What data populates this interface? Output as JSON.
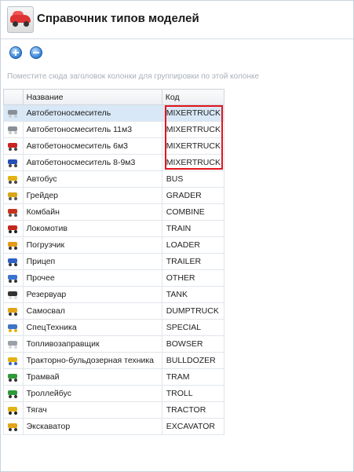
{
  "window": {
    "title": "Справочник типов моделей"
  },
  "toolbar": {
    "add_icon": "plus-circle-icon",
    "remove_icon": "minus-circle-icon"
  },
  "group_panel": {
    "hint": "Поместите сюда заголовок колонки для группировки по этой колонке"
  },
  "table": {
    "columns": [
      "",
      "Название",
      "Код"
    ],
    "rows": [
      {
        "icon": "mixer-truck-icon",
        "name": "Автобетоносмеситель",
        "code": "MIXERTRUCK",
        "selected": true
      },
      {
        "icon": "mixer-truck-icon",
        "name": "Автобетоносмеситель 11м3",
        "code": "MIXERTRUCK"
      },
      {
        "icon": "mixer-truck-red-icon",
        "name": "Автобетоносмеситель 6м3",
        "code": "MIXERTRUCK"
      },
      {
        "icon": "mixer-truck-blue-icon",
        "name": "Автобетоносмеситель 8-9м3",
        "code": "MIXERTRUCK"
      },
      {
        "icon": "bus-icon",
        "name": "Автобус",
        "code": "BUS"
      },
      {
        "icon": "grader-icon",
        "name": "Грейдер",
        "code": "GRADER"
      },
      {
        "icon": "combine-icon",
        "name": "Комбайн",
        "code": "COMBINE"
      },
      {
        "icon": "locomotive-icon",
        "name": "Локомотив",
        "code": "TRAIN"
      },
      {
        "icon": "loader-icon",
        "name": "Погрузчик",
        "code": "LOADER"
      },
      {
        "icon": "trailer-icon",
        "name": "Прицеп",
        "code": "TRAILER"
      },
      {
        "icon": "car-icon",
        "name": "Прочее",
        "code": "OTHER"
      },
      {
        "icon": "tank-icon",
        "name": "Резервуар",
        "code": "TANK"
      },
      {
        "icon": "dumptruck-icon",
        "name": "Самосвал",
        "code": "DUMPTRUCK"
      },
      {
        "icon": "special-vehicle-icon",
        "name": "СпецТехника",
        "code": "SPECIAL"
      },
      {
        "icon": "bowser-icon",
        "name": "Топливозаправщик",
        "code": "BOWSER"
      },
      {
        "icon": "bulldozer-icon",
        "name": "Тракторно-бульдозерная техника",
        "code": "BULLDOZER"
      },
      {
        "icon": "tram-icon",
        "name": "Трамвай",
        "code": "TRAM"
      },
      {
        "icon": "trolleybus-icon",
        "name": "Троллейбус",
        "code": "TROLL"
      },
      {
        "icon": "tractor-icon",
        "name": "Тягач",
        "code": "TRACTOR"
      },
      {
        "icon": "excavator-icon",
        "name": "Экскаватор",
        "code": "EXCAVATOR"
      }
    ]
  },
  "colors": {
    "selection": "#d8e8f7",
    "highlight_box": "#e3151f",
    "accent": "#3a86d8"
  }
}
